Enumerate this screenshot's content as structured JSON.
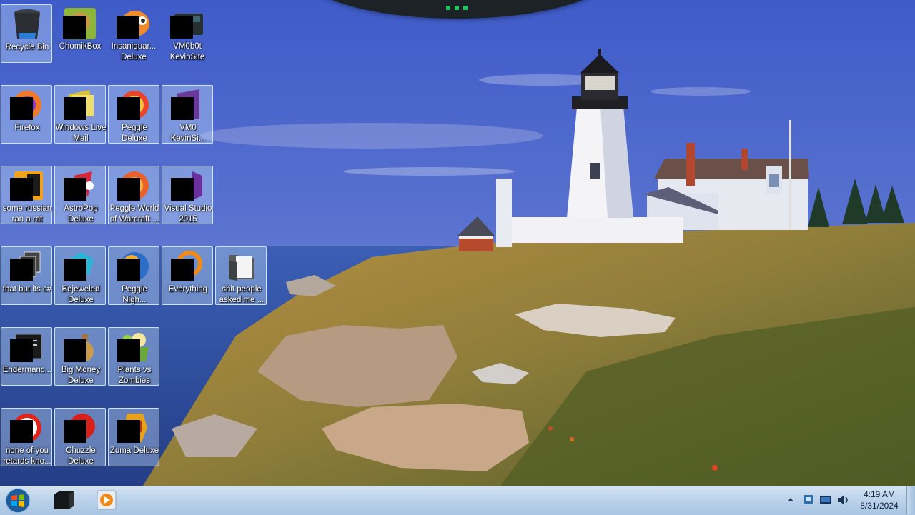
{
  "desktop": {
    "icons": [
      {
        "label": "Recycle Bin",
        "icon": "recycle-bin-icon"
      },
      {
        "label": "ChomikBox",
        "icon": "chomikbox-icon"
      },
      {
        "label": "Insaniquar... Deluxe",
        "icon": "insaniquarium-icon"
      },
      {
        "label": "VM0b0t KevinSite",
        "icon": "vm0b0t-icon"
      },
      {
        "label": "Firefox",
        "icon": "firefox-icon"
      },
      {
        "label": "Windows Live Mail",
        "icon": "windows-live-mail-icon"
      },
      {
        "label": "Peggle Deluxe",
        "icon": "peggle-icon"
      },
      {
        "label": "VM0 KevinSi...",
        "icon": "vm0-icon"
      },
      {
        "label": "some russian ran a rat",
        "icon": "rat-icon"
      },
      {
        "label": "AstroPop Deluxe",
        "icon": "astropop-icon"
      },
      {
        "label": "Peggle World of Warcraft ...",
        "icon": "peggle-wow-icon"
      },
      {
        "label": "Visual Studio 2015",
        "icon": "visual-studio-icon"
      },
      {
        "label": "that but its c#",
        "icon": "document-stack-icon"
      },
      {
        "label": "Bejeweled Deluxe",
        "icon": "bejeweled-icon"
      },
      {
        "label": "Peggle Nigh...",
        "icon": "peggle-nights-icon"
      },
      {
        "label": "Everything",
        "icon": "everything-search-icon"
      },
      {
        "label": "shit people asked me ...",
        "icon": "folder-icon"
      },
      {
        "label": "Endermanc...",
        "icon": "terminal-icon"
      },
      {
        "label": "Big Money Deluxe",
        "icon": "big-money-icon"
      },
      {
        "label": "Plants vs Zombies",
        "icon": "plants-vs-zombies-icon"
      },
      {
        "label": "none of you retards kno...",
        "icon": "none-of-you-icon"
      },
      {
        "label": "Chuzzle Deluxe",
        "icon": "chuzzle-icon"
      },
      {
        "label": "Zuma Deluxe",
        "icon": "zuma-icon"
      }
    ]
  },
  "taskbar": {
    "start_icon": "windows-start-orb-icon",
    "pinned": [
      {
        "icon": "black-box-app-icon"
      },
      {
        "icon": "media-player-icon"
      }
    ],
    "tray": {
      "icons": [
        "show-hidden-icons-chevron",
        "network-icon",
        "display-icon",
        "volume-icon"
      ],
      "time": "4:19 AM",
      "date": "8/31/2024"
    }
  },
  "colors": {
    "taskbar": "#bcd3ea",
    "sky": "#4a63c4",
    "sea": "#3a5aa8",
    "grass": "#8a7a3a"
  }
}
